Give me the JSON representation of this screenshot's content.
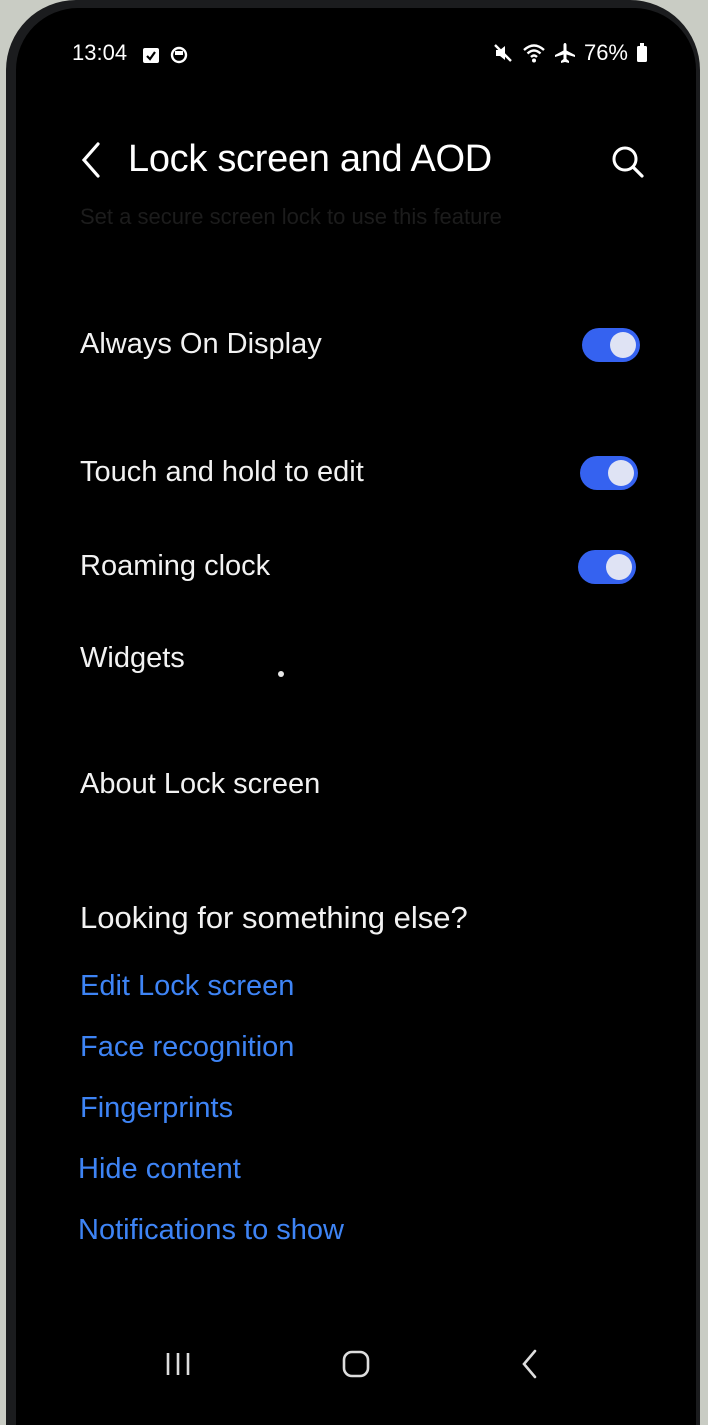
{
  "status_bar": {
    "time": "13:04",
    "battery": "76%",
    "notification_icons": [
      "calendar-check-icon",
      "circle-icon"
    ],
    "system_icons": [
      "mute-icon",
      "wifi-icon",
      "airplane-icon",
      "battery-icon"
    ]
  },
  "header": {
    "title": "Lock screen and AOD"
  },
  "hint_text": "Set a secure screen lock to use this feature",
  "settings": [
    {
      "label": "Always On Display",
      "toggle": true,
      "on": true
    },
    {
      "label": "Touch and hold to edit",
      "toggle": true,
      "on": true
    },
    {
      "label": "Roaming clock",
      "toggle": true,
      "on": true
    },
    {
      "label": "Widgets",
      "toggle": false
    },
    {
      "label": "About Lock screen",
      "toggle": false
    }
  ],
  "suggestions": {
    "heading": "Looking for something else?",
    "links": [
      "Edit Lock screen",
      "Face recognition",
      "Fingerprints",
      "Hide content",
      "Notifications to show"
    ]
  },
  "navigation_bar": [
    "recents-icon",
    "home-icon",
    "back-icon"
  ],
  "colors": {
    "background": "#000000",
    "text": "#f2f2f2",
    "accent_toggle": "#3562f0",
    "link": "#3e84f5"
  }
}
